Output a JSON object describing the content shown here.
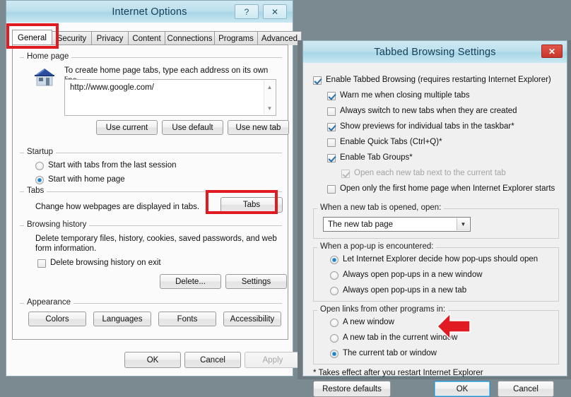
{
  "internet_options": {
    "title": "Internet Options",
    "titlebar_buttons": [
      {
        "name": "help-button",
        "glyph": "?"
      },
      {
        "name": "close-button",
        "glyph": "✕"
      }
    ],
    "tabs": [
      {
        "label": "General",
        "active": true
      },
      {
        "label": "Security",
        "active": false
      },
      {
        "label": "Privacy",
        "active": false
      },
      {
        "label": "Content",
        "active": false
      },
      {
        "label": "Connections",
        "active": false
      },
      {
        "label": "Programs",
        "active": false
      },
      {
        "label": "Advanced",
        "active": false
      }
    ],
    "home_page": {
      "group_label": "Home page",
      "description": "To create home page tabs, type each address on its own line.",
      "address_value": "http://www.google.com/",
      "buttons": [
        "Use current",
        "Use default",
        "Use new tab"
      ]
    },
    "startup": {
      "group_label": "Startup",
      "options": [
        {
          "label": "Start with tabs from the last session",
          "selected": false
        },
        {
          "label": "Start with home page",
          "selected": true
        }
      ]
    },
    "tabs_section": {
      "group_label": "Tabs",
      "description": "Change how webpages are displayed in tabs.",
      "button": "Tabs"
    },
    "browsing_history": {
      "group_label": "Browsing history",
      "description_line1": "Delete temporary files, history, cookies, saved passwords, and web",
      "description_line2": "form information.",
      "checkbox": {
        "label": "Delete browsing history on exit",
        "checked": false
      },
      "buttons": [
        "Delete...",
        "Settings"
      ]
    },
    "appearance": {
      "group_label": "Appearance",
      "buttons": [
        "Colors",
        "Languages",
        "Fonts",
        "Accessibility"
      ]
    },
    "footer_buttons": [
      {
        "label": "OK",
        "disabled": false
      },
      {
        "label": "Cancel",
        "disabled": false
      },
      {
        "label": "Apply",
        "disabled": true
      }
    ]
  },
  "tabbed_browsing": {
    "title": "Tabbed Browsing Settings",
    "close_glyph": "✕",
    "checkboxes": [
      {
        "label": "Enable Tabbed Browsing (requires restarting Internet Explorer)",
        "checked": true,
        "indent": 0,
        "disabled": false
      },
      {
        "label": "Warn me when closing multiple tabs",
        "checked": true,
        "indent": 1,
        "disabled": false
      },
      {
        "label": "Always switch to new tabs when they are created",
        "checked": false,
        "indent": 1,
        "disabled": false
      },
      {
        "label": "Show previews for individual tabs in the taskbar*",
        "checked": true,
        "indent": 1,
        "disabled": false
      },
      {
        "label": "Enable Quick Tabs (Ctrl+Q)*",
        "checked": false,
        "indent": 1,
        "disabled": false
      },
      {
        "label": "Enable Tab Groups*",
        "checked": true,
        "indent": 1,
        "disabled": false
      },
      {
        "label": "Open each new tab next to the current tab",
        "checked": true,
        "indent": 2,
        "disabled": true
      },
      {
        "label": "Open only the first home page when Internet Explorer starts",
        "checked": false,
        "indent": 1,
        "disabled": false
      }
    ],
    "new_tab_group": {
      "label": "When a new tab is opened, open:",
      "selected_option": "The new tab page"
    },
    "popup_group": {
      "label": "When a pop-up is encountered:",
      "options": [
        {
          "label": "Let Internet Explorer decide how pop-ups should open",
          "selected": true
        },
        {
          "label": "Always open pop-ups in a new window",
          "selected": false
        },
        {
          "label": "Always open pop-ups in a new tab",
          "selected": false
        }
      ]
    },
    "links_group": {
      "label": "Open links from other programs in:",
      "options": [
        {
          "label": "A new window",
          "selected": false
        },
        {
          "label": "A new tab in the current window",
          "selected": false
        },
        {
          "label": "The current tab or window",
          "selected": true
        }
      ]
    },
    "footnote": "* Takes effect after you restart Internet Explorer",
    "footer_buttons": [
      {
        "label": "Restore defaults",
        "focused": false
      },
      {
        "label": "OK",
        "focused": true
      },
      {
        "label": "Cancel",
        "focused": false
      }
    ]
  },
  "annotations": {
    "accent_color": "#e11b22",
    "highlights": [
      "general-tab",
      "tabs-button"
    ],
    "arrow_points_to": "The current tab or window"
  }
}
